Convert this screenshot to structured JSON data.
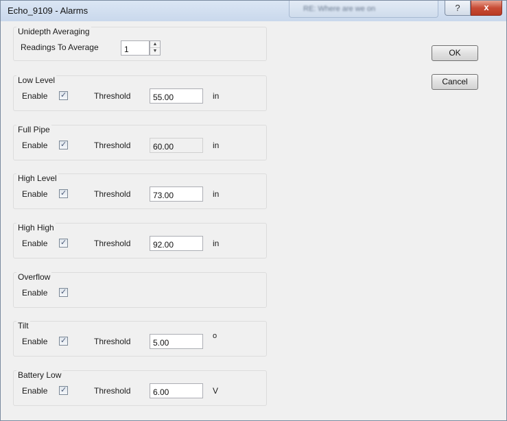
{
  "window": {
    "title": "Echo_9109 - Alarms",
    "background_tab_text": "RE: Where are we on",
    "help_glyph": "?",
    "close_glyph": "x"
  },
  "unidepth": {
    "title": "Unidepth Averaging",
    "readings_label": "Readings To Average",
    "readings_value": "1",
    "spin_up": "▲",
    "spin_down": "▼"
  },
  "groups": {
    "low_level": {
      "title": "Low Level",
      "enable_label": "Enable",
      "enable_checked": true,
      "threshold_label": "Threshold",
      "value": "55.00",
      "unit": "in"
    },
    "full_pipe": {
      "title": "Full Pipe",
      "enable_label": "Enable",
      "enable_checked": true,
      "threshold_label": "Threshold",
      "value": "60.00",
      "unit": "in"
    },
    "high_level": {
      "title": "High Level",
      "enable_label": "Enable",
      "enable_checked": true,
      "threshold_label": "Threshold",
      "value": "73.00",
      "unit": "in"
    },
    "high_high": {
      "title": "High High",
      "enable_label": "Enable",
      "enable_checked": true,
      "threshold_label": "Threshold",
      "value": "92.00",
      "unit": "in"
    },
    "overflow": {
      "title": "Overflow",
      "enable_label": "Enable",
      "enable_checked": true
    },
    "tilt": {
      "title": "Tilt",
      "enable_label": "Enable",
      "enable_checked": true,
      "threshold_label": "Threshold",
      "value": "5.00",
      "unit": "o"
    },
    "battery_low": {
      "title": "Battery Low",
      "enable_label": "Enable",
      "enable_checked": true,
      "threshold_label": "Threshold",
      "value": "6.00",
      "unit": "V"
    }
  },
  "buttons": {
    "ok_label": "OK",
    "cancel_label": "Cancel"
  }
}
